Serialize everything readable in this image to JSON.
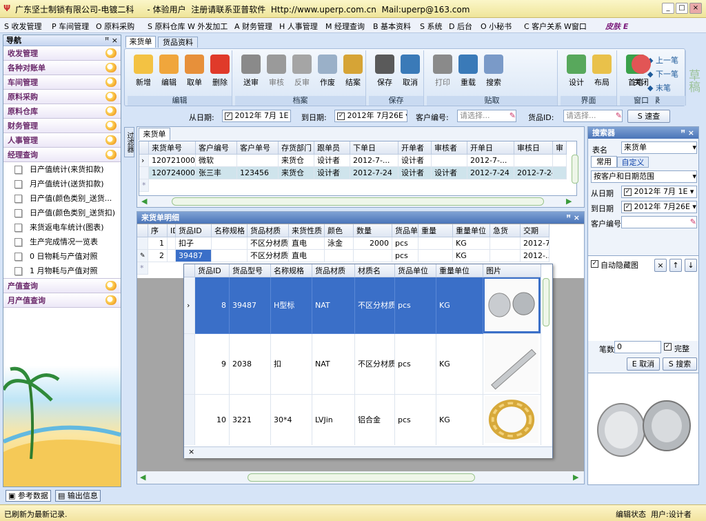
{
  "title": {
    "app": "广东坚士制锁有限公司-电镀二科",
    "user": "- 体验用户",
    "register": "注册请联系亚普软件",
    "url": "Http://www.uperp.com.cn",
    "mail": "Mail:uperp@163.com"
  },
  "menu": [
    "S 收发管理",
    "P 车间管理",
    "O 原料采购",
    "S 原料仓库",
    "W 外发加工",
    "A 财务管理",
    "H 人事管理",
    "M 经理查询",
    "B 基本资料",
    "S 系统",
    "D 后台",
    "O 小秘书",
    "C 客户关系",
    "W窗口",
    "皮肤 E"
  ],
  "nav": {
    "title": "导航",
    "groups_top": [
      "收发管理",
      "各种对账单",
      "车间管理",
      "原料采购",
      "原料仓库",
      "财务管理",
      "人事管理",
      "经理查询"
    ],
    "items": [
      "日产值统计(来货扣款)",
      "月产值统计(送货扣款)",
      "日产值(颜色类别_送货...",
      "日产值(颜色类别_送货扣)",
      "来货返电车统计(图表)",
      "生产完成情况一览表",
      "0 日物耗与产值对照",
      "1 月物耗与产值对照"
    ],
    "groups_bottom": [
      "产值查询",
      "月产值查询"
    ]
  },
  "tabs": [
    "来货单",
    "货品资料"
  ],
  "toolbar": {
    "groups": [
      "编辑",
      "档案",
      "保存",
      "贴取",
      "界面",
      "记录",
      "窗口"
    ],
    "buttons": [
      "新增",
      "编辑",
      "取单",
      "删除",
      "送审",
      "审核",
      "反审",
      "作废",
      "结案",
      "保存",
      "取消",
      "打印",
      "重载",
      "搜索",
      "设计",
      "布局",
      "首笔"
    ],
    "record": [
      "上一笔",
      "下一笔",
      "末笔"
    ],
    "close": "关闭",
    "draft": "草稿"
  },
  "filter": {
    "from_label": "从日期:",
    "from": "2012年 7月 1E",
    "to_label": "到日期:",
    "to": "2012年 7月26E",
    "cust_label": "客户编号:",
    "cust_ph": "请选择...",
    "item_label": "货品ID:",
    "item_ph": "请选择...",
    "query": "S 速查"
  },
  "master": {
    "tab": "来货单",
    "cols": [
      "来货单号",
      "客户编号",
      "客户单号",
      "存货部门",
      "跟单员",
      "下单日",
      "开单者",
      "审核者",
      "开单日",
      "审核日",
      "审"
    ],
    "rows": [
      [
        "1207210002",
        "微软",
        "",
        "来货仓",
        "设计者",
        "2012-7-...",
        "设计者",
        "",
        "2012-7-...",
        "",
        ""
      ],
      [
        "1207240002",
        "张三丰",
        "123456",
        "来货仓",
        "设计者",
        "2012-7-24",
        "设计者",
        "设计者",
        "2012-7-24",
        "2012-7-24",
        ""
      ]
    ]
  },
  "sidetab": "过滤器",
  "detail": {
    "title": "来货单明细",
    "cols": [
      "序",
      "ID",
      "货品ID",
      "名称规格",
      "货品材质",
      "来货性质",
      "颜色",
      "数量",
      "货品单位",
      "重量",
      "重量单位",
      "急货",
      "交期"
    ],
    "rows": [
      [
        "1",
        "",
        "扣子",
        "",
        "不区分材质",
        "直电",
        "泳金",
        "2000",
        "pcs",
        "",
        "KG",
        "",
        "2012-7-2"
      ],
      [
        "2",
        "",
        "39487",
        "",
        "不区分材质",
        "直电",
        "",
        "",
        "pcs",
        "",
        "KG",
        "",
        "2012-..."
      ]
    ]
  },
  "popup": {
    "cols": [
      "货品ID",
      "货品型号",
      "名称规格",
      "货品材质",
      "材质名",
      "货品单位",
      "重量单位",
      "图片"
    ],
    "rows": [
      [
        "8",
        "39487",
        "H型标",
        "NAT",
        "不区分材质",
        "pcs",
        "KG"
      ],
      [
        "9",
        "2038",
        "扣",
        "NAT",
        "不区分材质",
        "pcs",
        "KG"
      ],
      [
        "10",
        "3221",
        "30*4",
        "LVJin",
        "铝合金",
        "pcs",
        "KG"
      ]
    ]
  },
  "search": {
    "title": "搜索器",
    "table_label": "表名",
    "table": "来货单",
    "tabs": [
      "常用",
      "自定义"
    ],
    "range": "按客户和日期范围",
    "from_label": "从日期",
    "from": "2012年 7月 1E",
    "to_label": "到日期",
    "to": "2012年 7月26E",
    "cust_label": "客户编号",
    "autohide": "自动隐藏图",
    "count_label": "笔数",
    "count": "0",
    "complete": "完整",
    "cancel": "E 取消",
    "search": "S 搜索"
  },
  "bottomtabs": [
    "参考数据",
    "输出信息"
  ],
  "status": {
    "msg": "已刷新为最新记录.",
    "edit": "编辑状态",
    "user": "用户:设计者"
  }
}
